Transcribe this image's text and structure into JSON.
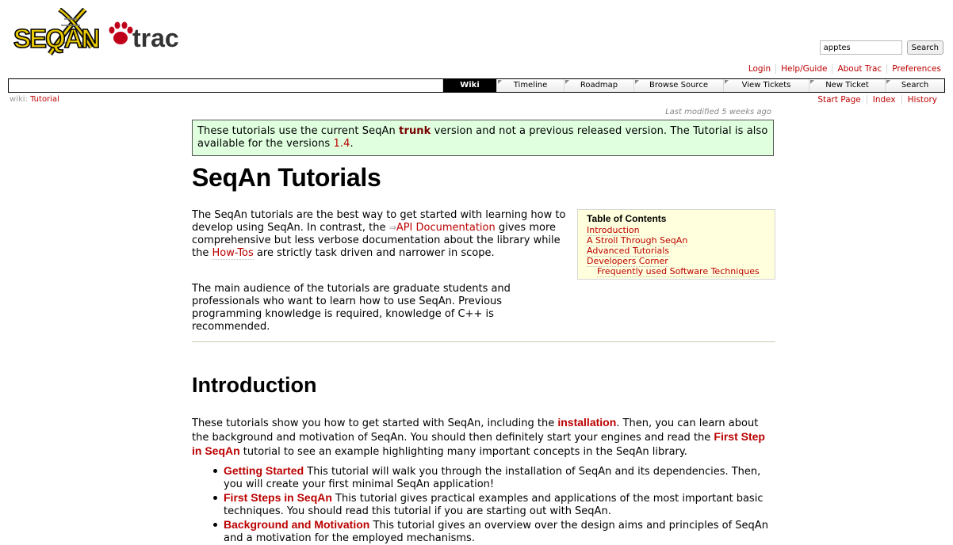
{
  "header": {
    "logo_text": "SEQAN trac",
    "search": {
      "value": "apptes",
      "button": "Search"
    },
    "metanav": [
      "Login",
      "Help/Guide",
      "About Trac",
      "Preferences"
    ]
  },
  "mainnav": {
    "tabs": [
      "Wiki",
      "Timeline",
      "Roadmap",
      "Browse Source",
      "View Tickets",
      "New Ticket",
      "Search"
    ],
    "active": "Wiki"
  },
  "ctxtnav": {
    "breadcrumb_prefix": "wiki:",
    "breadcrumb_page": "Tutorial",
    "links": [
      "Start Page",
      "Index",
      "History"
    ]
  },
  "page": {
    "last_modified": "Last modified 5 weeks ago",
    "notice": {
      "t1": "These tutorials use the current SeqAn ",
      "b1": "trunk",
      "t2": " version and not a previous released version. The Tutorial is also available for the versions ",
      "link": "1.4",
      "t3": "."
    },
    "title": "SeqAn Tutorials",
    "p1": {
      "t1": "The SeqAn tutorials are the best way to get started with learning how to develop using SeqAn. In contrast, the ",
      "link1": "API Documentation",
      "t2": " gives more comprehensive but less verbose documentation about the library while the ",
      "link2": "How-Tos",
      "t3": " are strictly task driven and narrower in scope."
    },
    "p2": "The main audience of the tutorials are graduate students and professionals who want to learn how to use SeqAn. Previous programming knowledge is required, knowledge of C++ is recommended.",
    "toc": {
      "heading": "Table of Contents",
      "items": [
        "Introduction",
        "A Stroll Through SeqAn",
        "Advanced Tutorials",
        "Developers Corner"
      ],
      "subitem": "Frequently used Software Techniques"
    },
    "intro": {
      "heading": "Introduction",
      "t1": "These tutorials show you how to get started with SeqAn, including the ",
      "link1": "installation",
      "t2": ". Then, you can learn about the background and motivation of SeqAn. You should then definitely start your engines and read the ",
      "link2": "First Step in SeqAn",
      "t3": " tutorial to see an example highlighting many important concepts in the SeqAn library.",
      "bullets": [
        {
          "link": "Getting Started",
          "text": " This tutorial will walk you through the installation of SeqAn and its dependencies. Then, you will create your first minimal SeqAn application!"
        },
        {
          "link": "First Steps in SeqAn",
          "text": " This tutorial gives practical examples and applications of the most important basic techniques. You should read this tutorial if you are starting out with SeqAn."
        },
        {
          "link": "Background and Motivation",
          "text": " This tutorial gives an overview over the design aims and principles of SeqAn and a motivation for the employed mechanisms."
        }
      ]
    }
  },
  "colors": {
    "link": "#bb0000",
    "notice_bg": "#dfffdf",
    "toc_bg": "#ffffdd"
  }
}
